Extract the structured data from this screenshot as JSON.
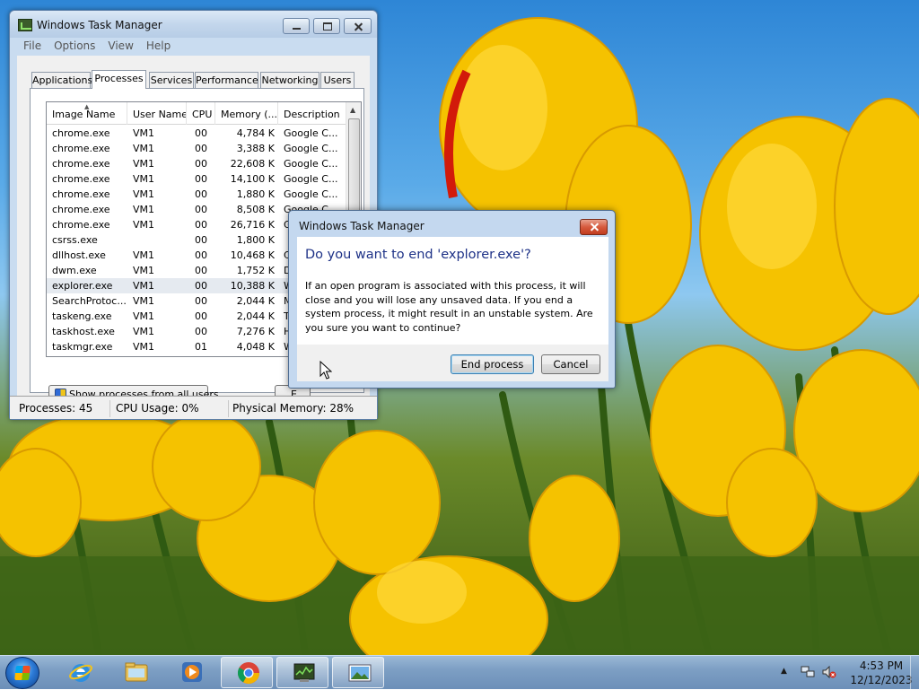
{
  "task_manager": {
    "title": "Windows Task Manager",
    "menu": [
      "File",
      "Options",
      "View",
      "Help"
    ],
    "tabs": [
      "Applications",
      "Processes",
      "Services",
      "Performance",
      "Networking",
      "Users"
    ],
    "active_tab": "Processes",
    "columns": [
      "Image Name",
      "User Name",
      "CPU",
      "Memory (...",
      "Description"
    ],
    "processes": [
      {
        "name": "chrome.exe",
        "user": "VM1",
        "cpu": "00",
        "memory": "4,784 K",
        "description": "Google C..."
      },
      {
        "name": "chrome.exe",
        "user": "VM1",
        "cpu": "00",
        "memory": "3,388 K",
        "description": "Google C..."
      },
      {
        "name": "chrome.exe",
        "user": "VM1",
        "cpu": "00",
        "memory": "22,608 K",
        "description": "Google C..."
      },
      {
        "name": "chrome.exe",
        "user": "VM1",
        "cpu": "00",
        "memory": "14,100 K",
        "description": "Google C..."
      },
      {
        "name": "chrome.exe",
        "user": "VM1",
        "cpu": "00",
        "memory": "1,880 K",
        "description": "Google C..."
      },
      {
        "name": "chrome.exe",
        "user": "VM1",
        "cpu": "00",
        "memory": "8,508 K",
        "description": "Google C..."
      },
      {
        "name": "chrome.exe",
        "user": "VM1",
        "cpu": "00",
        "memory": "26,716 K",
        "description": "Goo"
      },
      {
        "name": "csrss.exe",
        "user": "",
        "cpu": "00",
        "memory": "1,800 K",
        "description": ""
      },
      {
        "name": "dllhost.exe",
        "user": "VM1",
        "cpu": "00",
        "memory": "10,468 K",
        "description": "CO"
      },
      {
        "name": "dwm.exe",
        "user": "VM1",
        "cpu": "00",
        "memory": "1,752 K",
        "description": "Des"
      },
      {
        "name": "explorer.exe",
        "user": "VM1",
        "cpu": "00",
        "memory": "10,388 K",
        "description": "Win"
      },
      {
        "name": "SearchProtoc...",
        "user": "VM1",
        "cpu": "00",
        "memory": "2,044 K",
        "description": "Mic"
      },
      {
        "name": "taskeng.exe",
        "user": "VM1",
        "cpu": "00",
        "memory": "2,044 K",
        "description": "Tas"
      },
      {
        "name": "taskhost.exe",
        "user": "VM1",
        "cpu": "00",
        "memory": "7,276 K",
        "description": "Hos"
      },
      {
        "name": "taskmgr.exe",
        "user": "VM1",
        "cpu": "01",
        "memory": "4,048 K",
        "description": "Win"
      }
    ],
    "selected_process": "explorer.exe",
    "show_all_button": "Show processes from all users",
    "end_process_button_partial": "E",
    "status": {
      "processes": "Processes: 45",
      "cpu": "CPU Usage: 0%",
      "memory": "Physical Memory: 28%"
    }
  },
  "dialog": {
    "title": "Windows Task Manager",
    "heading": "Do you want to end 'explorer.exe'?",
    "message": "If an open program is associated with this process, it will close and you will lose any unsaved data. If you end a system process, it might result in an unstable system. Are you sure you want to continue?",
    "confirm_button": "End process",
    "cancel_button": "Cancel"
  },
  "taskbar": {
    "pinned": [
      "start-orb",
      "internet-explorer-icon",
      "windows-explorer-icon",
      "media-player-icon",
      "chrome-icon",
      "task-manager-icon",
      "picture-viewer-icon"
    ],
    "active_item": "task-manager-icon",
    "clock_time": "4:53 PM",
    "clock_date": "12/12/2023"
  }
}
